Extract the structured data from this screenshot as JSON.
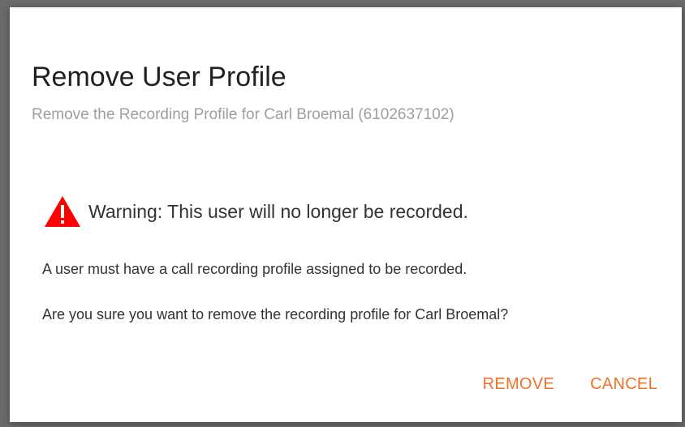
{
  "dialog": {
    "title": "Remove User Profile",
    "subtitle": "Remove the Recording Profile for Carl Broemal (6102637102)",
    "warning": {
      "icon": "warning-triangle-icon",
      "icon_color": "#ff0000",
      "text": "Warning: This user will no longer be recorded."
    },
    "paragraphs": [
      "A user must have a call recording profile assigned to be recorded.",
      "Are you sure you want to remove the recording profile for Carl Broemal?"
    ],
    "buttons": {
      "remove": "REMOVE",
      "cancel": "CANCEL"
    },
    "accent_color": "#f0702a"
  }
}
